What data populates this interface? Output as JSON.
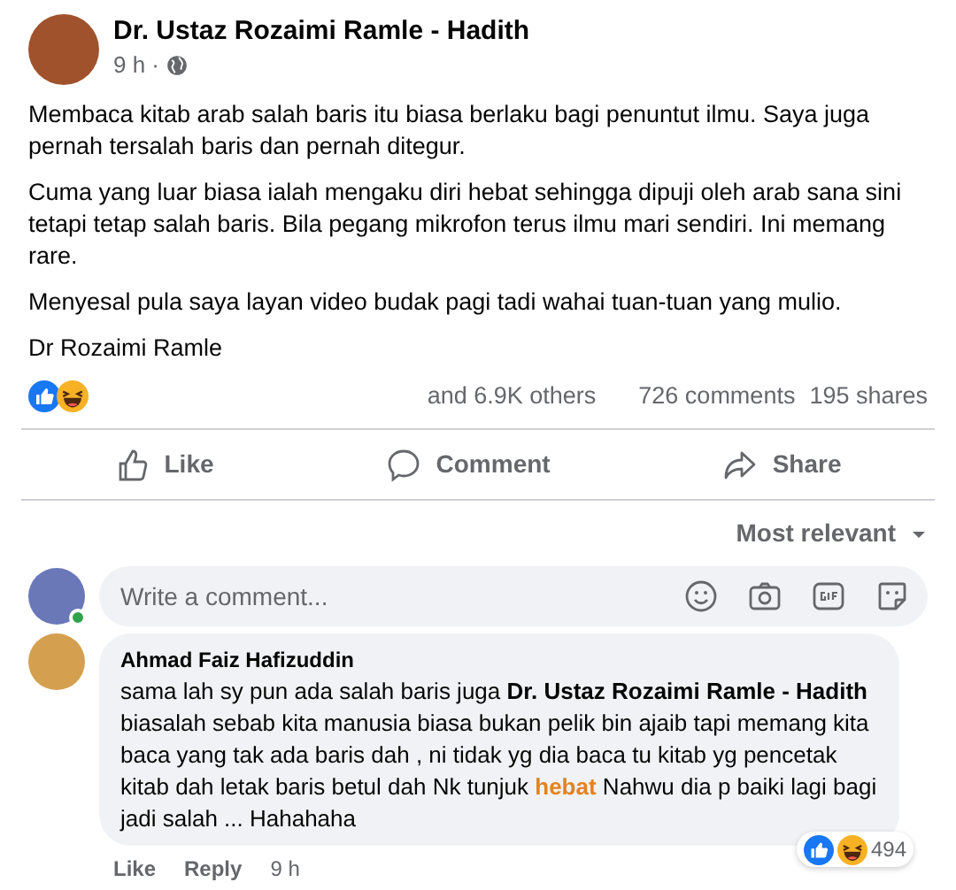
{
  "post": {
    "author": "Dr. Ustaz Rozaimi Ramle - Hadith",
    "time": "9 h ·",
    "paragraphs": [
      "Membaca kitab arab salah baris itu biasa berlaku bagi penuntut ilmu. Saya juga pernah tersalah baris dan pernah ditegur.",
      "Cuma yang luar biasa ialah mengaku diri hebat sehingga dipuji oleh arab sana sini tetapi tetap salah baris. Bila pegang mikrofon terus ilmu mari sendiri. Ini memang rare.",
      "Menyesal pula saya layan video budak pagi tadi wahai tuan-tuan yang mulio.",
      "Dr Rozaimi Ramle"
    ],
    "reactions": {
      "icons": [
        {
          "kind": "like"
        },
        {
          "kind": "haha"
        }
      ],
      "others": "and 6.9K others",
      "comments": "726 comments",
      "shares": "195 shares"
    },
    "actions": [
      {
        "kind": "like",
        "label": "Like"
      },
      {
        "kind": "comment",
        "label": "Comment"
      },
      {
        "kind": "share",
        "label": "Share"
      }
    ]
  },
  "sort": "Most relevant",
  "composer": {
    "placeholder": "Write a comment...",
    "online": true
  },
  "comment": {
    "author": "Ahmad Faiz Hafizuddin",
    "segments": [
      {
        "kind": "plain",
        "text": "sama lah sy pun ada salah baris juga "
      },
      {
        "kind": "mention",
        "text": "Dr. Ustaz Rozaimi Ramle - Hadith"
      },
      {
        "kind": "plain",
        "text": " biasalah sebab kita manusia biasa bukan pelik bin ajaib tapi memang kita baca yang tak ada baris dah , ni tidak yg dia baca tu kitab yg pencetak kitab dah letak baris betul dah Nk tunjuk "
      },
      {
        "kind": "keyword",
        "text": "hebat"
      },
      {
        "kind": "plain",
        "text": " Nahwu dia p baiki lagi bagi jadi salah ... Hahahaha"
      }
    ],
    "reaction_icons": [
      {
        "kind": "like"
      },
      {
        "kind": "haha"
      }
    ],
    "reaction_count": "494",
    "actions": [
      "Like",
      "Reply"
    ],
    "time": "9 h"
  }
}
